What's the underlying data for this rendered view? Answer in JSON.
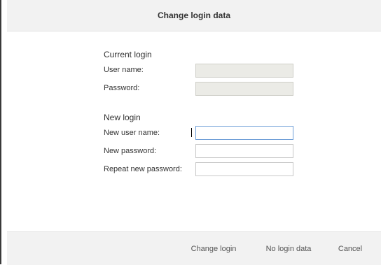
{
  "dialog": {
    "title": "Change login data"
  },
  "current_login": {
    "heading": "Current login",
    "user_name_label": "User name:",
    "user_name_value": "",
    "password_label": "Password:",
    "password_value": ""
  },
  "new_login": {
    "heading": "New login",
    "new_user_name_label": "New user name:",
    "new_user_name_value": "",
    "new_password_label": "New password:",
    "new_password_value": "",
    "repeat_password_label": "Repeat new password:",
    "repeat_password_value": ""
  },
  "footer": {
    "change_login_label": "Change login",
    "no_login_data_label": "No login data",
    "cancel_label": "Cancel"
  }
}
